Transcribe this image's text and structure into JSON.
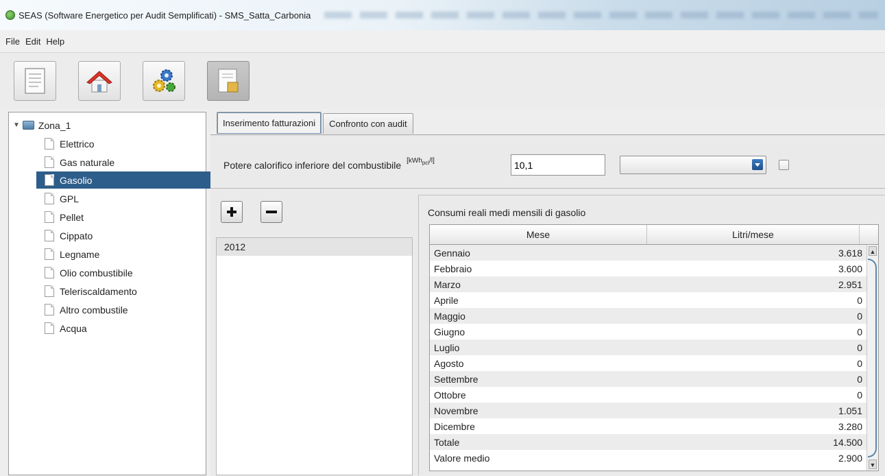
{
  "window": {
    "title": "SEAS (Software Energetico per Audit Semplificati) - SMS_Satta_Carbonia"
  },
  "menu": [
    "File",
    "Edit",
    "Help"
  ],
  "toolbar": {
    "buttons": [
      {
        "icon": "document-icon"
      },
      {
        "icon": "home-icon"
      },
      {
        "icon": "gears-icon"
      },
      {
        "icon": "bill-icon",
        "active": true
      }
    ]
  },
  "tree": {
    "root": "Zona_1",
    "items": [
      "Elettrico",
      "Gas naturale",
      "Gasolio",
      "GPL",
      "Pellet",
      "Cippato",
      "Legname",
      "Olio combustibile",
      "Teleriscaldamento",
      "Altro combustile",
      "Acqua"
    ],
    "selected": "Gasolio"
  },
  "tabs": [
    "Inserimento fatturazioni",
    "Confronto con audit"
  ],
  "pci": {
    "label": "Potere calorifico inferiore del combustibile",
    "unit": "[kWh",
    "unit_sub": "pci",
    "unit_end": "/l]",
    "value": "10,1"
  },
  "years": [
    "2012"
  ],
  "consumi": {
    "title": "Consumi reali medi mensili di gasolio",
    "headers": [
      "Mese",
      "Litri/mese"
    ],
    "rows": [
      {
        "mese": "Gennaio",
        "litri": "3.618"
      },
      {
        "mese": "Febbraio",
        "litri": "3.600"
      },
      {
        "mese": "Marzo",
        "litri": "2.951"
      },
      {
        "mese": "Aprile",
        "litri": "0"
      },
      {
        "mese": "Maggio",
        "litri": "0"
      },
      {
        "mese": "Giugno",
        "litri": "0"
      },
      {
        "mese": "Luglio",
        "litri": "0"
      },
      {
        "mese": "Agosto",
        "litri": "0"
      },
      {
        "mese": "Settembre",
        "litri": "0"
      },
      {
        "mese": "Ottobre",
        "litri": "0"
      },
      {
        "mese": "Novembre",
        "litri": "1.051"
      },
      {
        "mese": "Dicembre",
        "litri": "3.280"
      },
      {
        "mese": "Totale",
        "litri": "14.500"
      },
      {
        "mese": "Valore medio",
        "litri": "2.900"
      }
    ]
  },
  "colors": {
    "selection": "#2d5d8a",
    "accent": "#5a86ad"
  }
}
